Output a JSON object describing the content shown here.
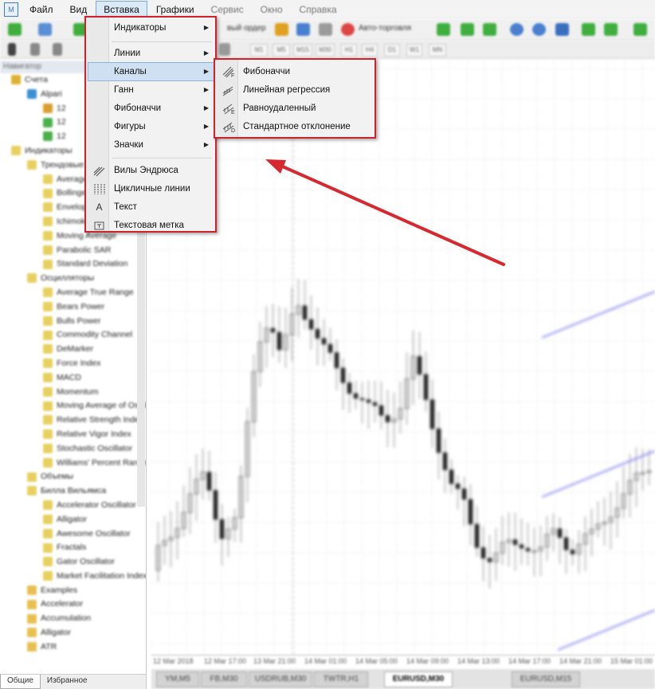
{
  "menubar": {
    "items": [
      {
        "label": "Файл"
      },
      {
        "label": "Вид"
      },
      {
        "label": "Вставка"
      },
      {
        "label": "Графики"
      },
      {
        "label": "Сервис"
      },
      {
        "label": "Окно"
      },
      {
        "label": "Справка"
      }
    ]
  },
  "insert_menu": {
    "items": [
      {
        "label": "Индикаторы"
      },
      {
        "label": "Линии"
      },
      {
        "label": "Каналы"
      },
      {
        "label": "Ганн"
      },
      {
        "label": "Фибоначчи"
      },
      {
        "label": "Фигуры"
      },
      {
        "label": "Значки"
      },
      {
        "label": "Вилы Эндрюса"
      },
      {
        "label": "Цикличные линии"
      },
      {
        "label": "Текст"
      },
      {
        "label": "Текстовая метка"
      }
    ],
    "text_icon_glyph": "A"
  },
  "channels_menu": {
    "items": [
      {
        "label": "Фибоначчи",
        "icon_letter": "F"
      },
      {
        "label": "Линейная регрессия",
        "icon_letter": ""
      },
      {
        "label": "Равноудаленный",
        "icon_letter": "E"
      },
      {
        "label": "Стандартное отклонение",
        "icon_letter": "D"
      }
    ]
  },
  "toolbar": {
    "new_order_label": "вый ордер",
    "autotrading_label": "Авто-торговля",
    "timeframes": [
      "M1",
      "M5",
      "M15",
      "M30",
      "H1",
      "H4",
      "D1",
      "W1",
      "MN"
    ]
  },
  "navigator": {
    "title": "Навигатор",
    "accounts": "Счета",
    "indicators": "Индикаторы",
    "trend": "Трендовые",
    "trend_items": [
      "Average Directional",
      "Bollinger Bands",
      "Envelopes",
      "Ichimoku Kinko Hyo",
      "Moving Average",
      "Parabolic SAR",
      "Standard Deviation"
    ],
    "oscillators": "Осцилляторы",
    "osc_items": [
      "Average True Range",
      "Bears Power",
      "Bulls Power",
      "Commodity Channel",
      "DeMarker",
      "Force Index",
      "MACD",
      "Momentum",
      "Moving Average of Oscillator",
      "Relative Strength Index",
      "Relative Vigor Index",
      "Stochastic Oscillator",
      "Williams' Percent Range"
    ],
    "volumes": "Объемы",
    "bill": "Билла Вильямса",
    "bill_items": [
      "Accelerator Oscillator",
      "Alligator",
      "Awesome Oscillator",
      "Fractals",
      "Gator Oscillator",
      "Market Facilitation Index"
    ],
    "examples": [
      "Examples",
      "Accelerator",
      "Accumulation",
      "Alligator",
      "ATR"
    ],
    "tab_common": "Общие",
    "tab_favorites": "Избранное"
  },
  "chart": {
    "x_labels": [
      "12 Mar 2018",
      "12 Mar 17:00",
      "13 Mar 21:00",
      "14 Mar 01:00",
      "14 Mar 05:00",
      "14 Mar 09:00",
      "14 Mar 13:00",
      "14 Mar 17:00",
      "14 Mar 21:00",
      "15 Mar 01:00"
    ],
    "tabs": [
      "YM,M5",
      "FB,M30",
      "USDRUB,M30",
      "TWTR,H1",
      "EURUSD,M30",
      "EURUSD,M15"
    ],
    "active_tab": 4
  },
  "colors": {
    "highlight": "#d0222e",
    "menu_hover": "#cfe0f2",
    "channel_line": "#8c8cf2"
  }
}
